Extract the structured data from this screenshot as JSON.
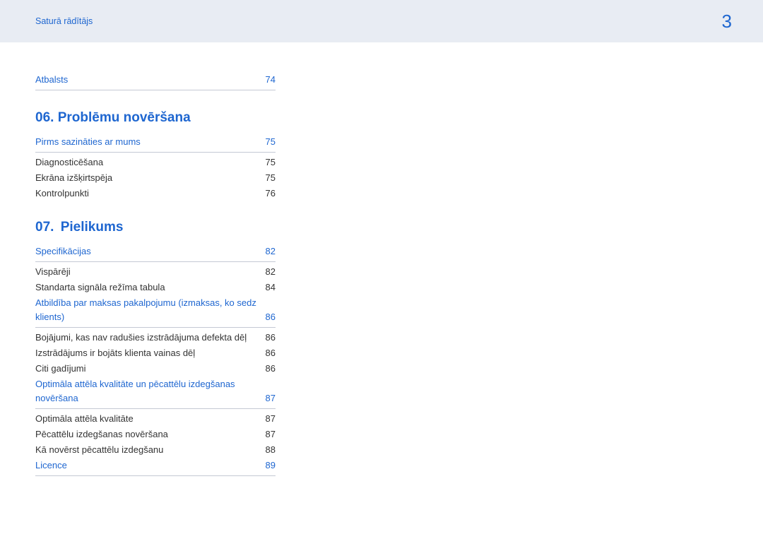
{
  "header": {
    "breadcrumb": "Saturā rādītājs",
    "page_number": "3"
  },
  "top_link": {
    "label": "Atbalsts",
    "page": "74"
  },
  "sections": [
    {
      "number": "06.",
      "title": "Problēmu novēršana",
      "groups": [
        {
          "head": {
            "label": "Pirms sazināties ar mums",
            "page": "75"
          },
          "items": [
            {
              "label": "Diagnosticēšana",
              "page": "75"
            },
            {
              "label": "Ekrāna izšķirtspēja",
              "page": "75"
            },
            {
              "label": "Kontrolpunkti",
              "page": "76"
            }
          ]
        }
      ]
    },
    {
      "number": "07.",
      "title": "Pielikums",
      "groups": [
        {
          "head": {
            "label": "Specifikācijas",
            "page": "82"
          },
          "items": [
            {
              "label": "Vispārēji",
              "page": "82"
            },
            {
              "label": "Standarta signāla režīma tabula",
              "page": "84"
            }
          ]
        },
        {
          "head_twoline": {
            "line1": "Atbildība par maksas pakalpojumu (izmaksas, ko sedz",
            "line2": "klients)",
            "page": "86"
          },
          "items": [
            {
              "label": "Bojājumi, kas nav radušies izstrādājuma defekta dēļ",
              "page": "86"
            },
            {
              "label": "Izstrādājums ir bojāts klienta vainas dēļ",
              "page": "86"
            },
            {
              "label": "Citi gadījumi",
              "page": "86"
            }
          ]
        },
        {
          "head_twoline": {
            "line1": "Optimāla attēla kvalitāte un pēcattēlu izdegšanas",
            "line2": "novēršana",
            "page": "87"
          },
          "items": [
            {
              "label": "Optimāla attēla kvalitāte",
              "page": "87"
            },
            {
              "label": "Pēcattēlu izdegšanas novēršana",
              "page": "87"
            },
            {
              "label": "Kā novērst pēcattēlu izdegšanu",
              "page": "88"
            }
          ]
        },
        {
          "head": {
            "label": "Licence",
            "page": "89"
          },
          "items": []
        }
      ]
    }
  ]
}
